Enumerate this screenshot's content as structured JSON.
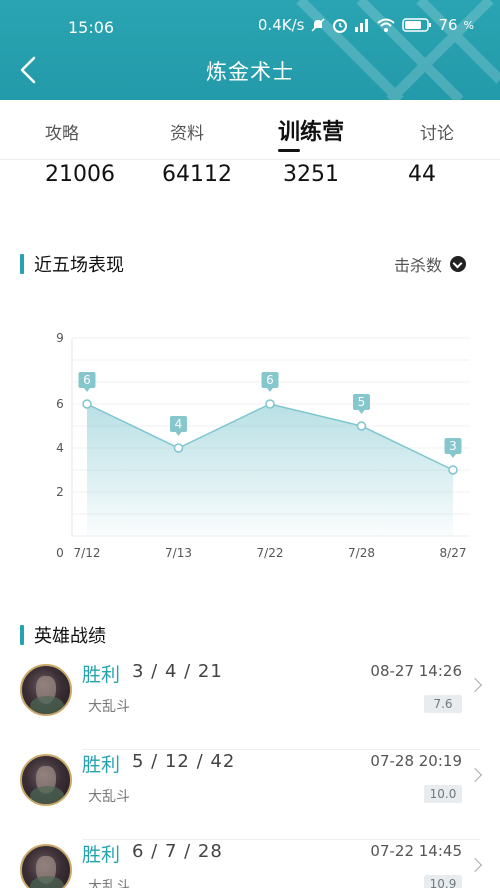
{
  "status_bar": {
    "time": "15:06",
    "network_speed": "0.4K/s",
    "battery": "76"
  },
  "header": {
    "title": "炼金术士"
  },
  "tabs": [
    {
      "label": "攻略",
      "active": false
    },
    {
      "label": "资料",
      "active": false
    },
    {
      "label": "训练营",
      "active": true
    },
    {
      "label": "讨论",
      "active": false
    }
  ],
  "stats": [
    "21006",
    "64112",
    "3251",
    "44"
  ],
  "recent": {
    "title": "近五场表现",
    "filter_label": "击杀数"
  },
  "chart_data": {
    "type": "area",
    "title": "",
    "xlabel": "",
    "ylabel": "",
    "categories": [
      "7/12",
      "7/13",
      "7/22",
      "7/28",
      "8/27"
    ],
    "values": [
      6,
      4,
      6,
      5,
      3
    ],
    "y_ticks": [
      0,
      2,
      4,
      6,
      9
    ],
    "ylim": [
      0,
      9
    ],
    "color": "#7ec6cf",
    "grid": true
  },
  "records": {
    "title": "英雄战绩",
    "matches": [
      {
        "result": "胜利",
        "kda": "3 / 4 / 21",
        "mode": "大乱斗",
        "time": "08-27 14:26",
        "score": "7.6"
      },
      {
        "result": "胜利",
        "kda": "5 / 12 / 42",
        "mode": "大乱斗",
        "time": "07-28 20:19",
        "score": "10.0"
      },
      {
        "result": "胜利",
        "kda": "6 / 7 / 28",
        "mode": "大乱斗",
        "time": "07-22 14:45",
        "score": "10.9"
      }
    ]
  },
  "colors": {
    "accent": "#26a3b1",
    "header_bg": "#2aa4b2",
    "chart_line": "#7ec6cf"
  }
}
